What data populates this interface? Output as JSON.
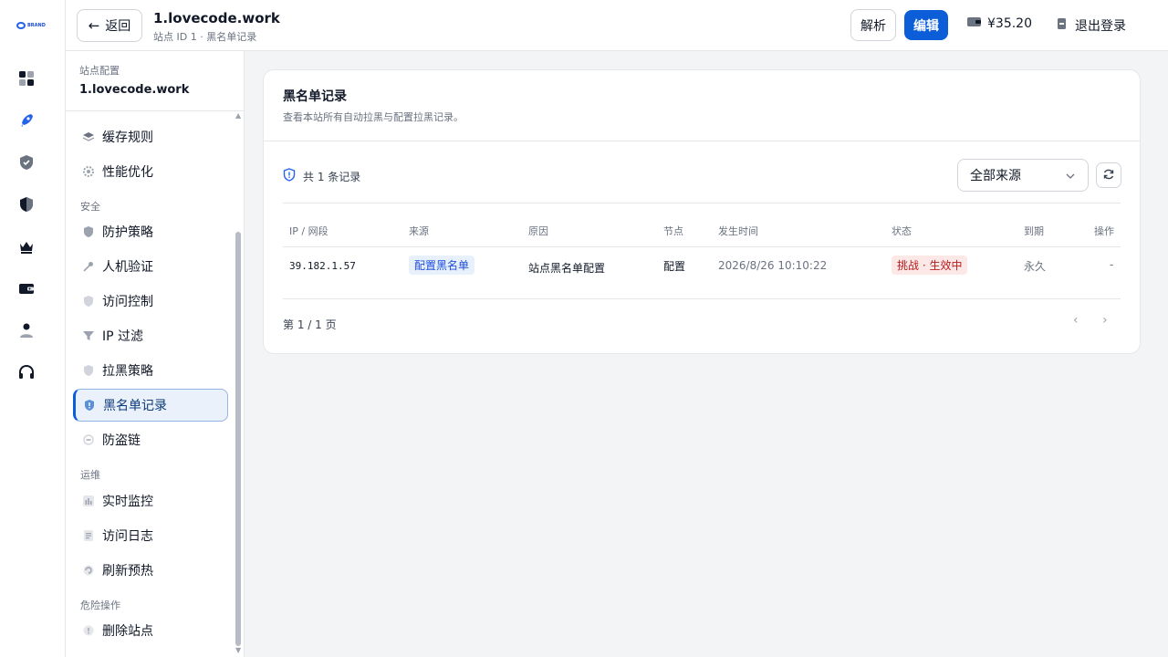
{
  "rail": {
    "logo_text": "BRAND",
    "items": [
      {
        "icon": "dashboard-icon"
      },
      {
        "icon": "rocket-icon"
      },
      {
        "icon": "shield-check-icon"
      },
      {
        "icon": "shield-half-icon"
      },
      {
        "icon": "crown-icon"
      },
      {
        "icon": "wallet-icon"
      },
      {
        "icon": "user-icon"
      },
      {
        "icon": "headset-icon"
      }
    ]
  },
  "header": {
    "back_label": "返回",
    "site_name": "1.lovecode.work",
    "subtitle": "站点 ID 1 · 黑名单记录",
    "parse_label": "解析",
    "edit_label": "编辑",
    "balance": "¥35.20",
    "logout_label": "退出登录"
  },
  "sidebar": {
    "section_label": "站点配置",
    "site_name": "1.lovecode.work",
    "items_top": [
      {
        "label": "缓存规则",
        "icon": "layers-icon"
      },
      {
        "label": "性能优化",
        "icon": "gear-icon"
      }
    ],
    "security_label": "安全",
    "security_items": [
      {
        "label": "防护策略",
        "icon": "shield-icon"
      },
      {
        "label": "人机验证",
        "icon": "key-icon"
      },
      {
        "label": "访问控制",
        "icon": "shield-lock-icon"
      },
      {
        "label": "IP 过滤",
        "icon": "filter-icon"
      },
      {
        "label": "拉黑策略",
        "icon": "shield-slash-icon"
      },
      {
        "label": "黑名单记录",
        "icon": "shield-alert-icon",
        "active": true
      },
      {
        "label": "防盗链",
        "icon": "link-icon"
      }
    ],
    "ops_label": "运维",
    "ops_items": [
      {
        "label": "实时监控",
        "icon": "bar-chart-icon"
      },
      {
        "label": "访问日志",
        "icon": "document-icon"
      },
      {
        "label": "刷新预热",
        "icon": "refresh-icon"
      }
    ],
    "danger_label": "危险操作",
    "danger_items": [
      {
        "label": "删除站点",
        "icon": "alert-circle-icon"
      }
    ]
  },
  "main": {
    "title": "黑名单记录",
    "description": "查看本站所有自动拉黑与配置拉黑记录。",
    "count_text": "共 1 条记录",
    "source_filter": "全部来源",
    "table": {
      "headers": [
        "IP / 网段",
        "来源",
        "原因",
        "节点",
        "发生时间",
        "状态",
        "到期",
        "操作"
      ],
      "rows": [
        {
          "ip": "39.182.1.57",
          "source": "配置黑名单",
          "reason": "站点黑名单配置",
          "node": "配置",
          "time": "2026/8/26 10:10:22",
          "status": "挑战 · 生效中",
          "expiry": "永久",
          "action": "-"
        }
      ]
    },
    "pager_text": "第 1 / 1 页"
  }
}
